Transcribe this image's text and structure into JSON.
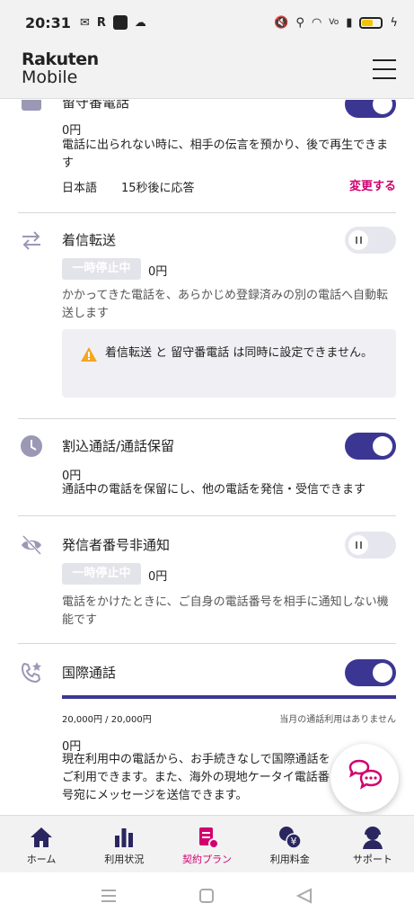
{
  "status_bar": {
    "time": "20:31",
    "left_icons": [
      "mail-icon",
      "r-icon",
      "app-icon",
      "cloud-icon"
    ],
    "right_icons": [
      "mute-icon",
      "location-icon",
      "wifi-icon",
      "volte-icon",
      "signal-icon"
    ]
  },
  "header": {
    "logo_line1": "Rakuten",
    "logo_line2": "Mobile"
  },
  "voicemail": {
    "title": "留守番電話",
    "enabled": true,
    "price": "0円",
    "description": "電話に出られない時に、相手の伝言を預かり、後で再生できます",
    "language": "日本語",
    "answer_after": "15秒後に応答",
    "change_label": "変更する"
  },
  "call_forwarding": {
    "title": "着信転送",
    "enabled": false,
    "paused_label": "一時停止中",
    "price": "0円",
    "description": "かかってきた電話を、あらかじめ登録済みの別の電話へ自動転送します",
    "warning": "着信転送 と 留守番電話 は同時に設定できません。"
  },
  "call_waiting": {
    "title": "割込通話/通話保留",
    "enabled": true,
    "price": "0円",
    "description": "通話中の電話を保留にし、他の電話を発信・受信できます"
  },
  "caller_id_block": {
    "title": "発信者番号非通知",
    "enabled": false,
    "paused_label": "一時停止中",
    "price": "0円",
    "description": "電話をかけたときに、ご自身の電話番号を相手に通知しない機能です"
  },
  "international_call": {
    "title": "国際通話",
    "enabled": true,
    "usage_fraction": 1.0,
    "limit_text": "20,000円 / 20,000円",
    "usage_status": "当月の通話利用はありません",
    "price": "0円",
    "description": "現在利用中の電話から、お手続きなしで国際通話をご利用できます。また、海外の現地ケータイ電話番号宛にメッセージを送信できます。"
  },
  "bottom_nav": [
    {
      "label": "ホーム",
      "icon": "home-icon",
      "active": false
    },
    {
      "label": "利用状況",
      "icon": "bar-chart-icon",
      "active": false
    },
    {
      "label": "契約プラン",
      "icon": "contract-icon",
      "active": true
    },
    {
      "label": "利用料金",
      "icon": "yen-icon",
      "active": false
    },
    {
      "label": "サポート",
      "icon": "support-icon",
      "active": false
    }
  ],
  "colors": {
    "accent": "#3c3693",
    "brand": "#d2006f",
    "paused": "#e3e3ea"
  }
}
